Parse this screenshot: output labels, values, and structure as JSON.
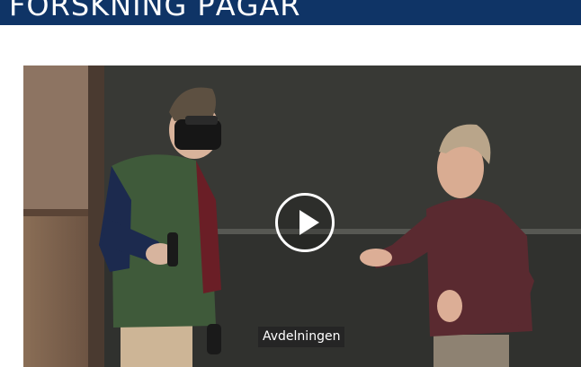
{
  "header": {
    "title": "FORSKNING PÅGÅR",
    "background_color": "#0f3466"
  },
  "video": {
    "caption": "Avdelningen",
    "play_icon": "play-icon"
  }
}
